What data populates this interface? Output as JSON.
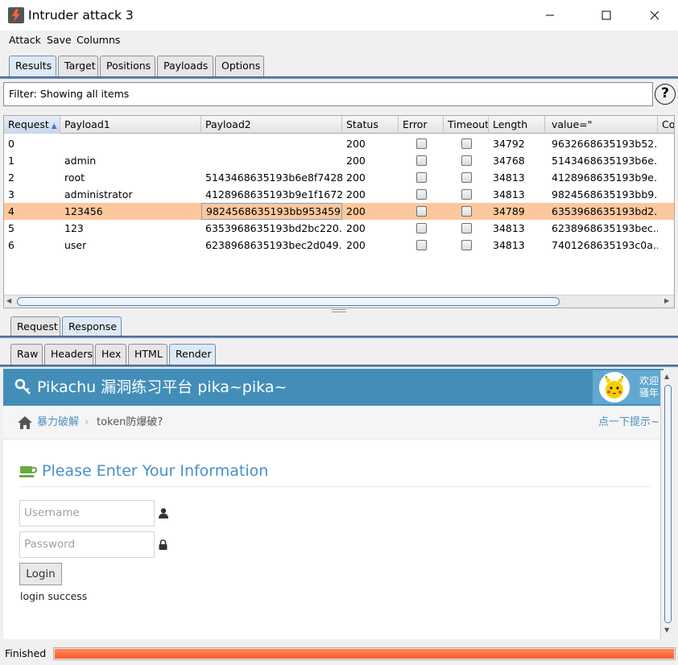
{
  "window": {
    "title": "Intruder attack 3"
  },
  "menu": [
    "Attack",
    "Save",
    "Columns"
  ],
  "main_tabs": [
    "Results",
    "Target",
    "Positions",
    "Payloads",
    "Options"
  ],
  "filter": {
    "text": "Filter: Showing all items",
    "help": "?"
  },
  "table": {
    "columns": [
      "Request",
      "Payload1",
      "Payload2",
      "Status",
      "Error",
      "Timeout",
      "Length",
      "value=\"",
      "Co"
    ],
    "rows": [
      {
        "request": "0",
        "payload1": "",
        "payload2": "",
        "status": "200",
        "error": false,
        "timeout": false,
        "length": "34792",
        "value": "9632668635193b52..."
      },
      {
        "request": "1",
        "payload1": "admin",
        "payload2": "",
        "status": "200",
        "error": false,
        "timeout": false,
        "length": "34768",
        "value": "5143468635193b6e..."
      },
      {
        "request": "2",
        "payload1": "root",
        "payload2": "5143468635193b6e8f7428...",
        "status": "200",
        "error": false,
        "timeout": false,
        "length": "34813",
        "value": "4128968635193b9e..."
      },
      {
        "request": "3",
        "payload1": "administrator",
        "payload2": "4128968635193b9e1f1672...",
        "status": "200",
        "error": false,
        "timeout": false,
        "length": "34813",
        "value": "9824568635193bb9..."
      },
      {
        "request": "4",
        "payload1": "123456",
        "payload2": "9824568635193bb953459...",
        "status": "200",
        "error": false,
        "timeout": false,
        "length": "34789",
        "value": "6353968635193bd2..."
      },
      {
        "request": "5",
        "payload1": "123",
        "payload2": "6353968635193bd2bc220...",
        "status": "200",
        "error": false,
        "timeout": false,
        "length": "34813",
        "value": "6238968635193bec..."
      },
      {
        "request": "6",
        "payload1": "user",
        "payload2": "6238968635193bec2d049...",
        "status": "200",
        "error": false,
        "timeout": false,
        "length": "34813",
        "value": "7401268635193c0a..."
      }
    ],
    "selected_row": 4
  },
  "msg_tabs": [
    "Request",
    "Response"
  ],
  "view_tabs": [
    "Raw",
    "Headers",
    "Hex",
    "HTML",
    "Render"
  ],
  "render": {
    "title": "Pikachu 漏洞练习平台 pika~pika~",
    "welcome": "欢迎骚年",
    "crumb_1": "暴力破解",
    "crumb_sep": "›",
    "crumb_2": "token防爆破?",
    "hint": "点一下提示~",
    "heading": "Please Enter Your Information",
    "username_placeholder": "Username",
    "password_placeholder": "Password",
    "login_button": "Login",
    "login_message": "login success"
  },
  "status": {
    "text": "Finished",
    "progress": 1.0
  },
  "colors": {
    "accent": "#438eb9",
    "selected_row": "#fcc79d",
    "progress": "#ff6a3a"
  }
}
